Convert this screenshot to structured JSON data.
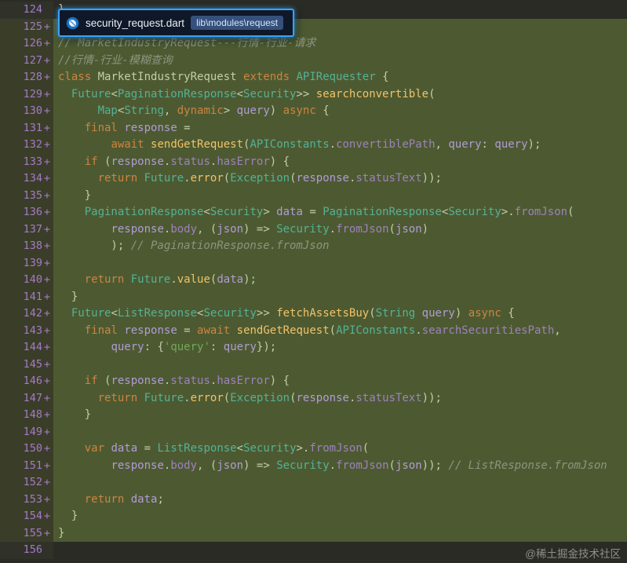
{
  "colors": {
    "added_line_bg": "#4d5a31",
    "editor_bg": "#2a2b25",
    "gutter_bg": "#30322a",
    "gutter_added_bg": "#3a3e28",
    "line_number": "#a57ac6",
    "accent_blue": "#38a2f8",
    "keyword": "#cd8441",
    "type": "#54b297",
    "function": "#f2c269",
    "string": "#74a85c",
    "comment": "#8c9480"
  },
  "tooltip": {
    "filename": "security_request.dart",
    "path": "lib\\modules\\request"
  },
  "watermark": {
    "text": "@稀土掘金技术社区"
  },
  "code": {
    "lines": [
      {
        "n": "124",
        "a": false,
        "t": [
          [
            "d",
            "}"
          ]
        ]
      },
      {
        "n": "125",
        "a": true,
        "t": []
      },
      {
        "n": "126",
        "a": true,
        "t": [
          [
            "c",
            "// MarketIndustryRequest---行情-行业-请求"
          ]
        ]
      },
      {
        "n": "127",
        "a": true,
        "t": [
          [
            "c",
            "//行情-行业-模糊查询"
          ]
        ]
      },
      {
        "n": "128",
        "a": true,
        "t": [
          [
            "k",
            "class"
          ],
          [
            "d",
            " MarketIndustryRequest "
          ],
          [
            "k",
            "extends"
          ],
          [
            "d",
            " "
          ],
          [
            "t",
            "APIRequester"
          ],
          [
            "d",
            " {"
          ]
        ]
      },
      {
        "n": "129",
        "a": true,
        "t": [
          [
            "d",
            "  "
          ],
          [
            "t",
            "Future"
          ],
          [
            "d",
            "<"
          ],
          [
            "t",
            "PaginationResponse"
          ],
          [
            "d",
            "<"
          ],
          [
            "t",
            "Security"
          ],
          [
            "d",
            ">> "
          ],
          [
            "f",
            "searchconvertible"
          ],
          [
            "d",
            "("
          ]
        ]
      },
      {
        "n": "130",
        "a": true,
        "t": [
          [
            "d",
            "      "
          ],
          [
            "t",
            "Map"
          ],
          [
            "d",
            "<"
          ],
          [
            "t",
            "String"
          ],
          [
            "d",
            ", "
          ],
          [
            "k",
            "dynamic"
          ],
          [
            "d",
            "> "
          ],
          [
            "v",
            "query"
          ],
          [
            "d",
            ") "
          ],
          [
            "k",
            "async"
          ],
          [
            "d",
            " {"
          ]
        ]
      },
      {
        "n": "131",
        "a": true,
        "t": [
          [
            "d",
            "    "
          ],
          [
            "k",
            "final"
          ],
          [
            "d",
            " "
          ],
          [
            "v",
            "response"
          ],
          [
            "d",
            " ="
          ]
        ]
      },
      {
        "n": "132",
        "a": true,
        "t": [
          [
            "d",
            "        "
          ],
          [
            "k",
            "await"
          ],
          [
            "d",
            " "
          ],
          [
            "f",
            "sendGetRequest"
          ],
          [
            "d",
            "("
          ],
          [
            "t",
            "APIConstants"
          ],
          [
            "d",
            "."
          ],
          [
            "p",
            "convertiblePath"
          ],
          [
            "d",
            ", "
          ],
          [
            "v",
            "query"
          ],
          [
            "d",
            ": "
          ],
          [
            "v",
            "query"
          ],
          [
            "d",
            ");"
          ]
        ]
      },
      {
        "n": "133",
        "a": true,
        "t": [
          [
            "d",
            "    "
          ],
          [
            "k",
            "if"
          ],
          [
            "d",
            " ("
          ],
          [
            "v",
            "response"
          ],
          [
            "d",
            "."
          ],
          [
            "p",
            "status"
          ],
          [
            "d",
            "."
          ],
          [
            "p",
            "hasError"
          ],
          [
            "d",
            ") {"
          ]
        ]
      },
      {
        "n": "134",
        "a": true,
        "t": [
          [
            "d",
            "      "
          ],
          [
            "k",
            "return"
          ],
          [
            "d",
            " "
          ],
          [
            "t",
            "Future"
          ],
          [
            "d",
            "."
          ],
          [
            "f",
            "error"
          ],
          [
            "d",
            "("
          ],
          [
            "t",
            "Exception"
          ],
          [
            "d",
            "("
          ],
          [
            "v",
            "response"
          ],
          [
            "d",
            "."
          ],
          [
            "p",
            "statusText"
          ],
          [
            "d",
            "));"
          ]
        ]
      },
      {
        "n": "135",
        "a": true,
        "t": [
          [
            "d",
            "    }"
          ]
        ]
      },
      {
        "n": "136",
        "a": true,
        "t": [
          [
            "d",
            "    "
          ],
          [
            "t",
            "PaginationResponse"
          ],
          [
            "d",
            "<"
          ],
          [
            "t",
            "Security"
          ],
          [
            "d",
            "> "
          ],
          [
            "v",
            "data"
          ],
          [
            "d",
            " = "
          ],
          [
            "t",
            "PaginationResponse"
          ],
          [
            "d",
            "<"
          ],
          [
            "t",
            "Security"
          ],
          [
            "d",
            ">."
          ],
          [
            "p",
            "fromJson"
          ],
          [
            "d",
            "("
          ]
        ]
      },
      {
        "n": "137",
        "a": true,
        "t": [
          [
            "d",
            "        "
          ],
          [
            "v",
            "response"
          ],
          [
            "d",
            "."
          ],
          [
            "p",
            "body"
          ],
          [
            "d",
            ", ("
          ],
          [
            "v",
            "json"
          ],
          [
            "d",
            ") => "
          ],
          [
            "t",
            "Security"
          ],
          [
            "d",
            "."
          ],
          [
            "p",
            "fromJson"
          ],
          [
            "d",
            "("
          ],
          [
            "v",
            "json"
          ],
          [
            "d",
            ")"
          ]
        ]
      },
      {
        "n": "138",
        "a": true,
        "t": [
          [
            "d",
            "        ); "
          ],
          [
            "c",
            "// PaginationResponse.fromJson"
          ]
        ]
      },
      {
        "n": "139",
        "a": true,
        "t": []
      },
      {
        "n": "140",
        "a": true,
        "t": [
          [
            "d",
            "    "
          ],
          [
            "k",
            "return"
          ],
          [
            "d",
            " "
          ],
          [
            "t",
            "Future"
          ],
          [
            "d",
            "."
          ],
          [
            "f",
            "value"
          ],
          [
            "d",
            "("
          ],
          [
            "v",
            "data"
          ],
          [
            "d",
            ");"
          ]
        ]
      },
      {
        "n": "141",
        "a": true,
        "t": [
          [
            "d",
            "  }"
          ]
        ]
      },
      {
        "n": "142",
        "a": true,
        "t": [
          [
            "d",
            "  "
          ],
          [
            "t",
            "Future"
          ],
          [
            "d",
            "<"
          ],
          [
            "t",
            "ListResponse"
          ],
          [
            "d",
            "<"
          ],
          [
            "t",
            "Security"
          ],
          [
            "d",
            ">> "
          ],
          [
            "f",
            "fetchAssetsBuy"
          ],
          [
            "d",
            "("
          ],
          [
            "t",
            "String"
          ],
          [
            "d",
            " "
          ],
          [
            "v",
            "query"
          ],
          [
            "d",
            ") "
          ],
          [
            "k",
            "async"
          ],
          [
            "d",
            " {"
          ]
        ]
      },
      {
        "n": "143",
        "a": true,
        "t": [
          [
            "d",
            "    "
          ],
          [
            "k",
            "final"
          ],
          [
            "d",
            " "
          ],
          [
            "v",
            "response"
          ],
          [
            "d",
            " = "
          ],
          [
            "k",
            "await"
          ],
          [
            "d",
            " "
          ],
          [
            "f",
            "sendGetRequest"
          ],
          [
            "d",
            "("
          ],
          [
            "t",
            "APIConstants"
          ],
          [
            "d",
            "."
          ],
          [
            "p",
            "searchSecuritiesPath"
          ],
          [
            "d",
            ","
          ]
        ]
      },
      {
        "n": "144",
        "a": true,
        "t": [
          [
            "d",
            "        "
          ],
          [
            "v",
            "query"
          ],
          [
            "d",
            ": {"
          ],
          [
            "s",
            "'query'"
          ],
          [
            "d",
            ": "
          ],
          [
            "v",
            "query"
          ],
          [
            "d",
            "});"
          ]
        ]
      },
      {
        "n": "145",
        "a": true,
        "t": []
      },
      {
        "n": "146",
        "a": true,
        "t": [
          [
            "d",
            "    "
          ],
          [
            "k",
            "if"
          ],
          [
            "d",
            " ("
          ],
          [
            "v",
            "response"
          ],
          [
            "d",
            "."
          ],
          [
            "p",
            "status"
          ],
          [
            "d",
            "."
          ],
          [
            "p",
            "hasError"
          ],
          [
            "d",
            ") {"
          ]
        ]
      },
      {
        "n": "147",
        "a": true,
        "t": [
          [
            "d",
            "      "
          ],
          [
            "k",
            "return"
          ],
          [
            "d",
            " "
          ],
          [
            "t",
            "Future"
          ],
          [
            "d",
            "."
          ],
          [
            "f",
            "error"
          ],
          [
            "d",
            "("
          ],
          [
            "t",
            "Exception"
          ],
          [
            "d",
            "("
          ],
          [
            "v",
            "response"
          ],
          [
            "d",
            "."
          ],
          [
            "p",
            "statusText"
          ],
          [
            "d",
            "));"
          ]
        ]
      },
      {
        "n": "148",
        "a": true,
        "t": [
          [
            "d",
            "    }"
          ]
        ]
      },
      {
        "n": "149",
        "a": true,
        "t": []
      },
      {
        "n": "150",
        "a": true,
        "t": [
          [
            "d",
            "    "
          ],
          [
            "k",
            "var"
          ],
          [
            "d",
            " "
          ],
          [
            "v",
            "data"
          ],
          [
            "d",
            " = "
          ],
          [
            "t",
            "ListResponse"
          ],
          [
            "d",
            "<"
          ],
          [
            "t",
            "Security"
          ],
          [
            "d",
            ">."
          ],
          [
            "p",
            "fromJson"
          ],
          [
            "d",
            "("
          ]
        ]
      },
      {
        "n": "151",
        "a": true,
        "t": [
          [
            "d",
            "        "
          ],
          [
            "v",
            "response"
          ],
          [
            "d",
            "."
          ],
          [
            "p",
            "body"
          ],
          [
            "d",
            ", ("
          ],
          [
            "v",
            "json"
          ],
          [
            "d",
            ") => "
          ],
          [
            "t",
            "Security"
          ],
          [
            "d",
            "."
          ],
          [
            "p",
            "fromJson"
          ],
          [
            "d",
            "("
          ],
          [
            "v",
            "json"
          ],
          [
            "d",
            ")); "
          ],
          [
            "c",
            "// ListResponse.fromJson"
          ]
        ]
      },
      {
        "n": "152",
        "a": true,
        "t": []
      },
      {
        "n": "153",
        "a": true,
        "t": [
          [
            "d",
            "    "
          ],
          [
            "k",
            "return"
          ],
          [
            "d",
            " "
          ],
          [
            "v",
            "data"
          ],
          [
            "d",
            ";"
          ]
        ]
      },
      {
        "n": "154",
        "a": true,
        "t": [
          [
            "d",
            "  }"
          ]
        ]
      },
      {
        "n": "155",
        "a": true,
        "t": [
          [
            "d",
            "}"
          ]
        ]
      },
      {
        "n": "156",
        "a": false,
        "t": []
      }
    ]
  }
}
